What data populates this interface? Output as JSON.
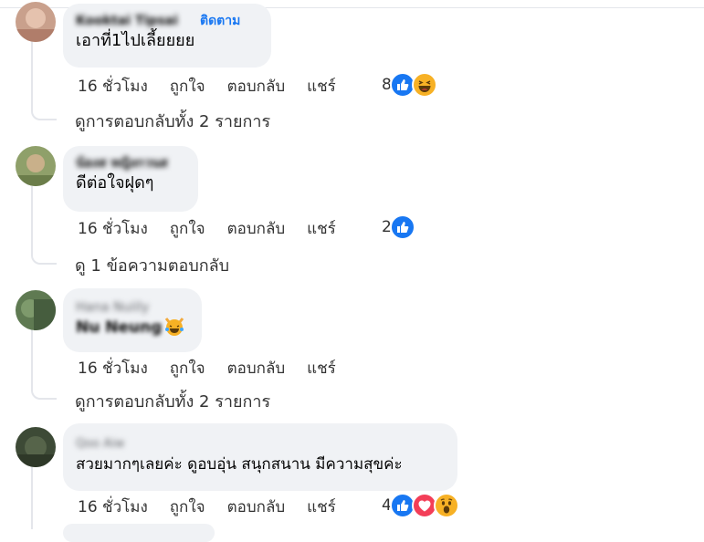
{
  "comments": [
    {
      "name": "Kooktai Tipsai",
      "follow": "ติดตาม",
      "text": "เอาที่1ไปเลี้ยยยย",
      "time": "16 ชั่วโมง",
      "like": "ถูกใจ",
      "reply": "ตอบกลับ",
      "share": "แชร์",
      "reaction_count": "8",
      "reactions": [
        "like-icon",
        "haha-icon"
      ],
      "view_replies": "ดูการตอบกลับทั้ง 2 รายการ"
    },
    {
      "name": "น้องส หญิงกวนส",
      "text": "ดีต่อใจฝุดๆ",
      "time": "16 ชั่วโมง",
      "like": "ถูกใจ",
      "reply": "ตอบกลับ",
      "share": "แชร์",
      "reaction_count": "2",
      "reactions": [
        "like-icon"
      ],
      "view_replies": "ดู 1 ข้อความตอบกลับ"
    },
    {
      "name": "Hana Nuiily",
      "text": "Nu Neung",
      "time": "16 ชั่วโมง",
      "like": "ถูกใจ",
      "reply": "ตอบกลับ",
      "share": "แชร์",
      "reactions": [
        "crying-laughing-cat-emoji"
      ],
      "view_replies": "ดูการตอบกลับทั้ง 2 รายการ"
    },
    {
      "name": "Qoo Aiw",
      "text": "สวยมากๆเลยค่ะ ดูอบอุ่น สนุกสนาน มีความสุขค่ะ",
      "time": "16 ชั่วโมง",
      "like": "ถูกใจ",
      "reply": "ตอบกลับ",
      "share": "แชร์",
      "reaction_count": "4",
      "reactions": [
        "like-icon",
        "love-icon",
        "wow-icon"
      ]
    }
  ],
  "colors": {
    "bubble": "#f0f2f5",
    "link": "#1877f2",
    "like": "#1877f2",
    "love": "#f33e58",
    "haha": "#f7b125",
    "meta": "#333333"
  }
}
